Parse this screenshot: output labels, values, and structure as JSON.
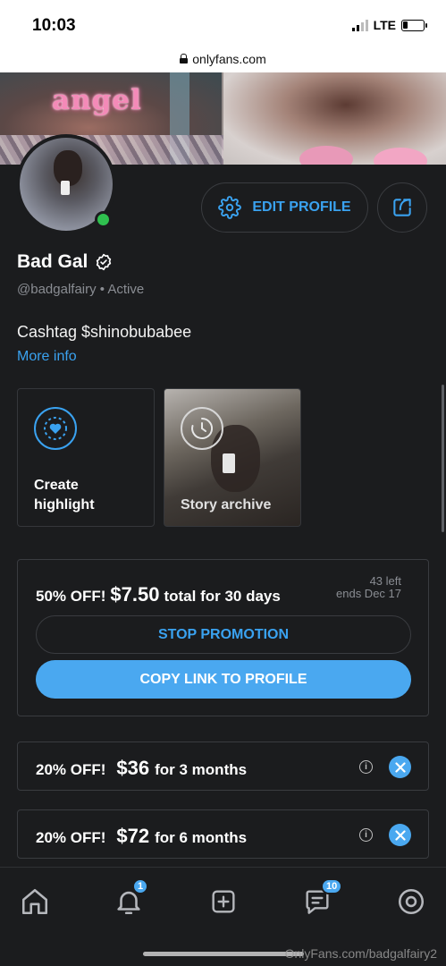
{
  "status_bar": {
    "time": "10:03",
    "network": "LTE",
    "battery_level": 0.25
  },
  "browser": {
    "url": "onlyfans.com"
  },
  "cover": {
    "overlay_text": "angel"
  },
  "profile": {
    "display_name": "Bad Gal",
    "handle": "@badgalfairy",
    "status": "Active",
    "bio": "Cashtag $shinobubabee",
    "more_info_label": "More info",
    "online": true
  },
  "actions": {
    "edit_profile_label": "EDIT PROFILE"
  },
  "highlights": [
    {
      "label": "Create highlight"
    },
    {
      "label": "Story archive"
    }
  ],
  "promotion": {
    "discount": "50% OFF!",
    "price": "$7.50",
    "description": "total for 30 days",
    "left": "43 left",
    "ends": "ends Dec 17",
    "stop_label": "STOP PROMOTION",
    "copy_label": "COPY LINK TO PROFILE"
  },
  "bundles": [
    {
      "discount": "20% OFF!",
      "price": "$36",
      "duration": "for 3 months"
    },
    {
      "discount": "20% OFF!",
      "price": "$72",
      "duration": "for 6 months"
    }
  ],
  "bottom_nav": {
    "notifications_badge": "1",
    "messages_badge": "10"
  },
  "watermark": "OnlyFans.com/badgalfairy2",
  "colors": {
    "accent": "#3aa2f0",
    "background": "#1b1c1e",
    "online": "#2fc04f"
  }
}
